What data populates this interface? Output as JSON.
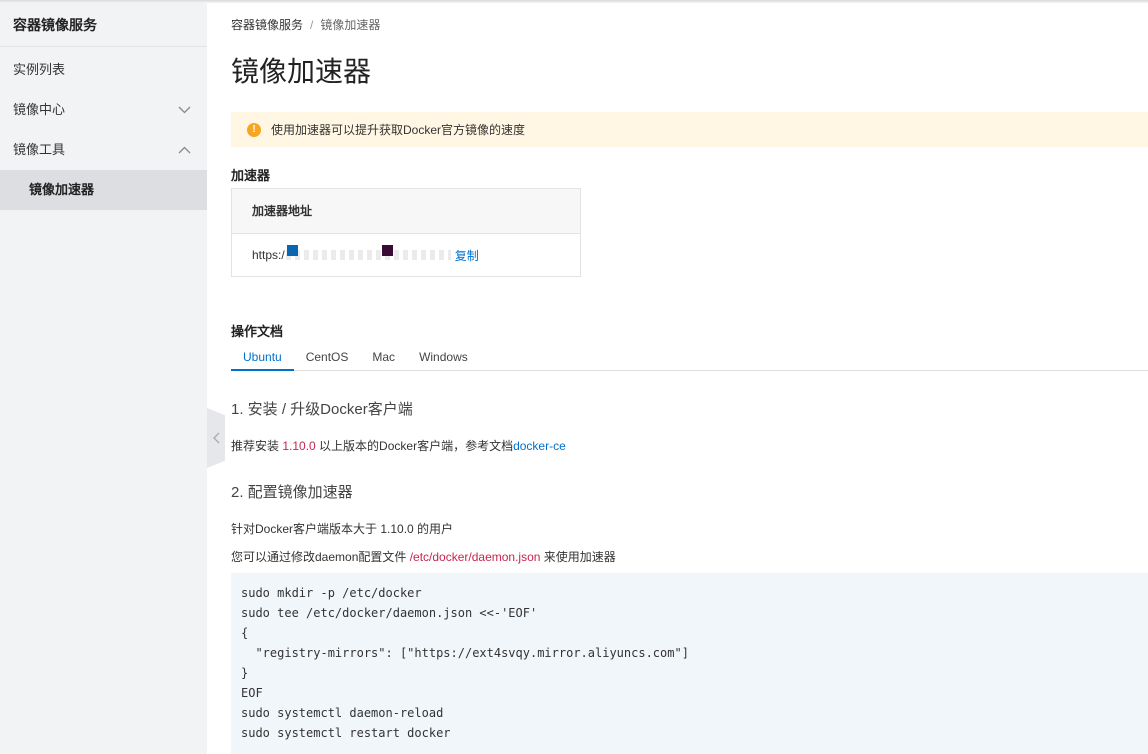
{
  "sidebar": {
    "title": "容器镜像服务",
    "items": [
      {
        "label": "实例列表"
      },
      {
        "label": "镜像中心"
      },
      {
        "label": "镜像工具"
      }
    ],
    "sub_item": "镜像加速器"
  },
  "breadcrumb": {
    "root": "容器镜像服务",
    "sep": "/",
    "current": "镜像加速器"
  },
  "page_title": "镜像加速器",
  "notice": {
    "icon": "!",
    "text": "使用加速器可以提升获取Docker官方镜像的速度"
  },
  "accelerator": {
    "section_title": "加速器",
    "table_header": "加速器地址",
    "url_prefix": "https:/",
    "copy_label": "复制"
  },
  "docs": {
    "section_title": "操作文档",
    "tabs": [
      "Ubuntu",
      "CentOS",
      "Mac",
      "Windows"
    ],
    "step1_title": "1. 安装 / 升级Docker客户端",
    "step1_text_a": "推荐安装 ",
    "step1_version": "1.10.0",
    "step1_text_b": " 以上版本的Docker客户端，参考文档",
    "step1_link": "docker-ce",
    "step2_title": "2. 配置镜像加速器",
    "step2_line1": "针对Docker客户端版本大于 1.10.0 的用户",
    "step2_line2_a": "您可以通过修改daemon配置文件 ",
    "step2_file": "/etc/docker/daemon.json",
    "step2_line2_b": " 来使用加速器",
    "code": [
      "sudo mkdir -p /etc/docker",
      "sudo tee /etc/docker/daemon.json <<-'EOF'",
      "{",
      "  \"registry-mirrors\": [\"https://ext4svqy.mirror.aliyuncs.com\"]",
      "}",
      "EOF",
      "sudo systemctl daemon-reload",
      "sudo systemctl restart docker"
    ]
  },
  "colors": {
    "accent": "#0070cc",
    "warning": "#f5a623",
    "notice_bg": "#fff7e3",
    "code_bg": "#f1f6fb",
    "highlight": "#c7254e"
  }
}
